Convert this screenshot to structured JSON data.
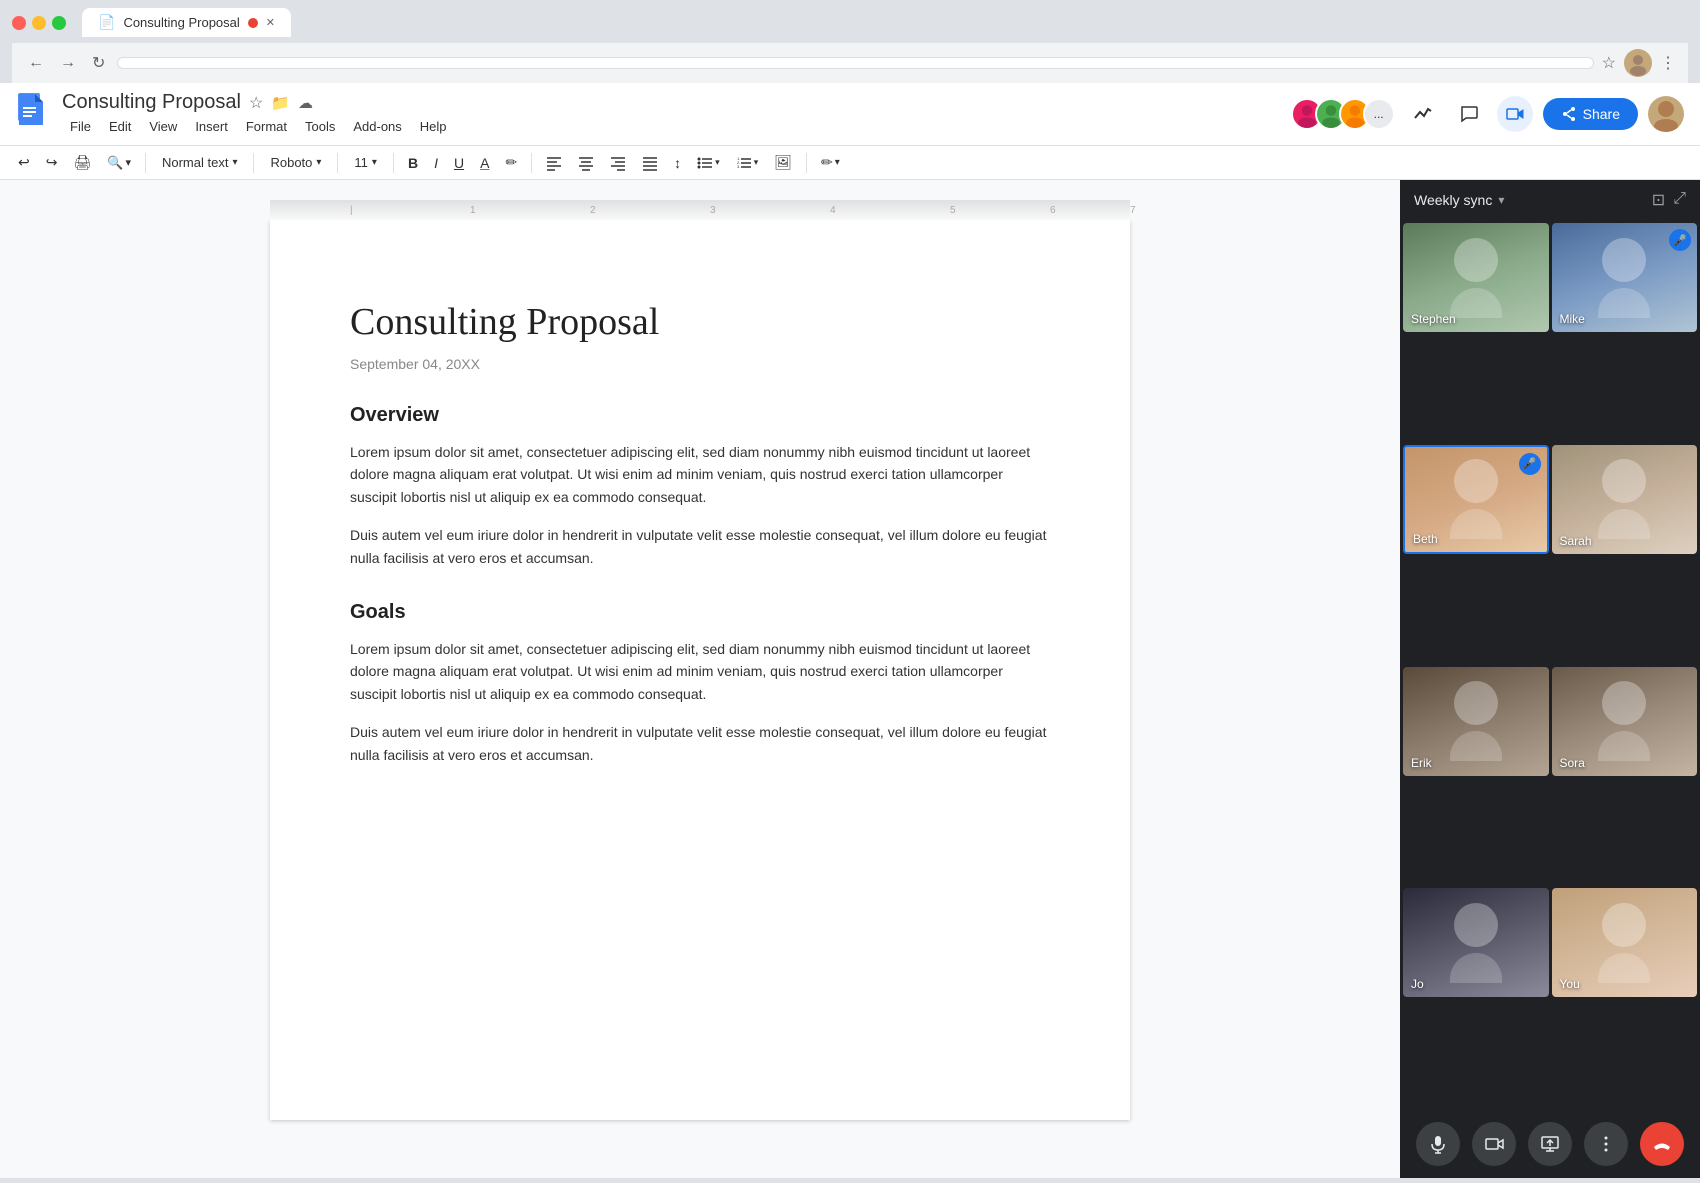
{
  "browser": {
    "tab_title": "Consulting Proposal",
    "tab_icon": "📄",
    "address_bar_placeholder": "",
    "back_label": "←",
    "forward_label": "→",
    "reload_label": "↻"
  },
  "app": {
    "logo_icon": "≡",
    "doc_title": "Consulting Proposal",
    "menu_items": [
      "File",
      "Edit",
      "View",
      "Insert",
      "Format",
      "Tools",
      "Add-ons",
      "Help"
    ],
    "toolbar": {
      "undo_label": "↩",
      "redo_label": "↪",
      "print_label": "🖨",
      "zoom_label": "🔍",
      "style_label": "Normal text",
      "font_label": "Roboto",
      "size_label": "11",
      "bold_label": "B",
      "italic_label": "I",
      "underline_label": "U",
      "font_color_label": "A",
      "highlight_label": "✏",
      "align_left_label": "≡",
      "align_center_label": "≡",
      "align_right_label": "≡",
      "justify_label": "≡",
      "line_spacing_label": "↕",
      "bullets_label": "•≡",
      "numbered_label": "1≡",
      "image_label": "🖼",
      "editing_label": "✏"
    },
    "share_button_label": "Share",
    "meet_title": "Weekly sync",
    "participants": [
      {
        "name": "Stephen",
        "speaking": false,
        "mic": false,
        "css_class": "person-stephen"
      },
      {
        "name": "Mike",
        "speaking": false,
        "mic": true,
        "css_class": "person-mike"
      },
      {
        "name": "Beth",
        "speaking": true,
        "mic": true,
        "css_class": "person-beth"
      },
      {
        "name": "Sarah",
        "speaking": false,
        "mic": false,
        "css_class": "person-sarah"
      },
      {
        "name": "Erik",
        "speaking": false,
        "mic": false,
        "css_class": "person-erik"
      },
      {
        "name": "Sora",
        "speaking": false,
        "mic": false,
        "css_class": "person-sora"
      },
      {
        "name": "Jo",
        "speaking": false,
        "mic": false,
        "css_class": "person-jo"
      },
      {
        "name": "You",
        "speaking": false,
        "mic": false,
        "css_class": "person-you"
      }
    ]
  },
  "document": {
    "title": "Consulting Proposal",
    "date": "September 04, 20XX",
    "sections": [
      {
        "heading": "Overview",
        "paragraphs": [
          "Lorem ipsum dolor sit amet, consectetuer adipiscing elit, sed diam nonummy nibh euismod tincidunt ut laoreet dolore magna aliquam erat volutpat. Ut wisi enim ad minim veniam, quis nostrud exerci tation ullamcorper suscipit lobortis nisl ut aliquip ex ea commodo consequat.",
          "Duis autem vel eum iriure dolor in hendrerit in vulputate velit esse molestie consequat, vel illum dolore eu feugiat nulla facilisis at vero eros et accumsan."
        ]
      },
      {
        "heading": "Goals",
        "paragraphs": [
          "Lorem ipsum dolor sit amet, consectetuer adipiscing elit, sed diam nonummy nibh euismod tincidunt ut laoreet dolore magna aliquam erat volutpat. Ut wisi enim ad minim veniam, quis nostrud exerci tation ullamcorper suscipit lobortis nisl ut aliquip ex ea commodo consequat.",
          "Duis autem vel eum iriure dolor in hendrerit in vulputate velit esse molestie consequat, vel illum dolore eu feugiat nulla facilisis at vero eros et accumsan."
        ]
      }
    ]
  },
  "colors": {
    "blue": "#1a73e8",
    "red": "#ea4335",
    "speaking_border": "#1a73e8",
    "mic_bg": "#1a73e8"
  }
}
